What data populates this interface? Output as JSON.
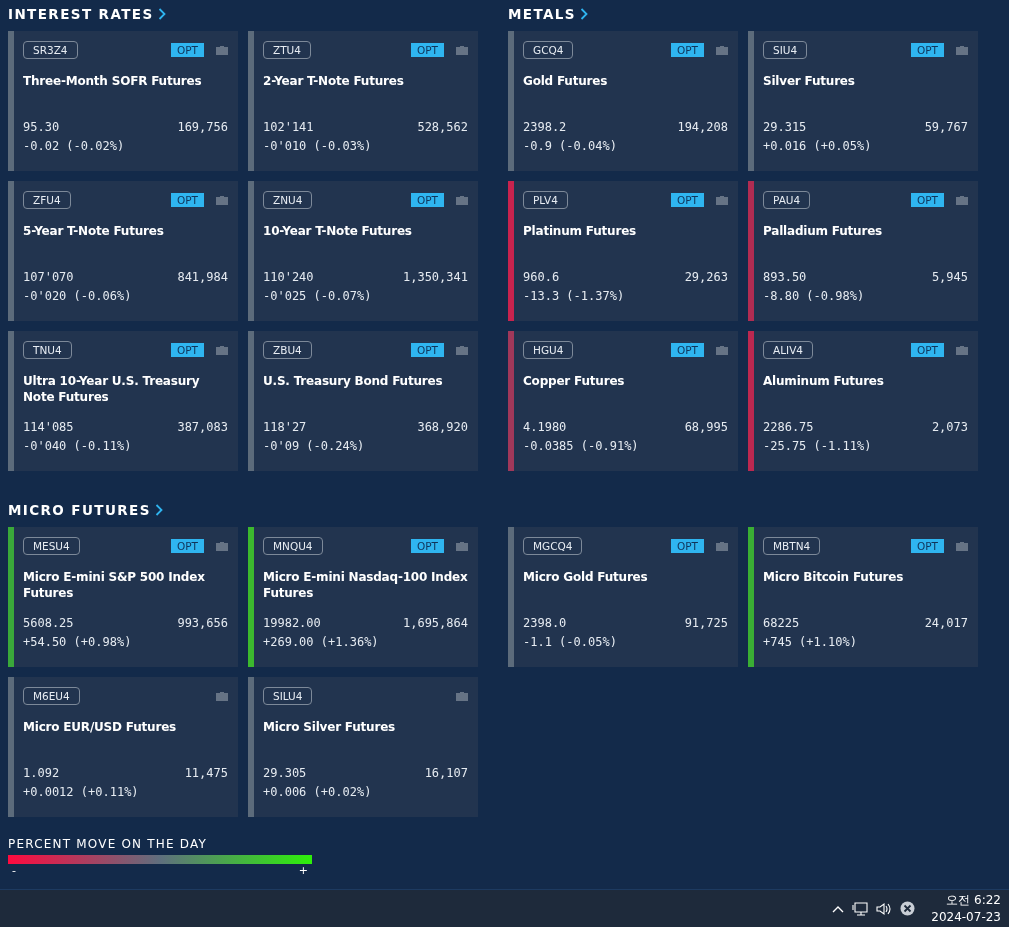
{
  "sections": [
    {
      "kind": "half",
      "title": "INTEREST RATES",
      "cards": [
        {
          "ticker": "SR3Z4",
          "badge": "OPT",
          "name": "Three-Month SOFR Futures",
          "price": "95.30",
          "volume": "169,756",
          "change": "-0.02 (-0.02%)",
          "color": "#5c6b7b"
        },
        {
          "ticker": "ZTU4",
          "badge": "OPT",
          "name": "2-Year T-Note Futures",
          "price": "102'141",
          "volume": "528,562",
          "change": "-0'010 (-0.03%)",
          "color": "#5c6b7b"
        },
        {
          "ticker": "ZFU4",
          "badge": "OPT",
          "name": "5-Year T-Note Futures",
          "price": "107'070",
          "volume": "841,984",
          "change": "-0'020 (-0.06%)",
          "color": "#5c6b7b"
        },
        {
          "ticker": "ZNU4",
          "badge": "OPT",
          "name": "10-Year T-Note Futures",
          "price": "110'240",
          "volume": "1,350,341",
          "change": "-0'025 (-0.07%)",
          "color": "#5c6b7b"
        },
        {
          "ticker": "TNU4",
          "badge": "OPT",
          "name": "Ultra 10-Year U.S. Treasury Note Futures",
          "price": "114'085",
          "volume": "387,083",
          "change": "-0'040 (-0.11%)",
          "color": "#5c6b7b"
        },
        {
          "ticker": "ZBU4",
          "badge": "OPT",
          "name": "U.S. Treasury Bond Futures",
          "price": "118'27",
          "volume": "368,920",
          "change": "-0'09 (-0.24%)",
          "color": "#5c6b7b"
        }
      ]
    },
    {
      "kind": "half",
      "title": "METALS",
      "cards": [
        {
          "ticker": "GCQ4",
          "badge": "OPT",
          "name": "Gold Futures",
          "price": "2398.2",
          "volume": "194,208",
          "change": "-0.9 (-0.04%)",
          "color": "#5c6b7b"
        },
        {
          "ticker": "SIU4",
          "badge": "OPT",
          "name": "Silver Futures",
          "price": "29.315",
          "volume": "59,767",
          "change": "+0.016 (+0.05%)",
          "color": "#5c6b7b"
        },
        {
          "ticker": "PLV4",
          "badge": "OPT",
          "name": "Platinum Futures",
          "price": "960.6",
          "volume": "29,263",
          "change": "-13.3 (-1.37%)",
          "color": "#c8234e"
        },
        {
          "ticker": "PAU4",
          "badge": "OPT",
          "name": "Palladium Futures",
          "price": "893.50",
          "volume": "5,945",
          "change": "-8.80 (-0.98%)",
          "color": "#b02c52"
        },
        {
          "ticker": "HGU4",
          "badge": "OPT",
          "name": "Copper Futures",
          "price": "4.1980",
          "volume": "68,995",
          "change": "-0.0385 (-0.91%)",
          "color": "#a0385a"
        },
        {
          "ticker": "ALIV4",
          "badge": "OPT",
          "name": "Aluminum Futures",
          "price": "2286.75",
          "volume": "2,073",
          "change": "-25.75 (-1.11%)",
          "color": "#bb2850"
        }
      ]
    },
    {
      "kind": "full",
      "title": "MICRO FUTURES",
      "cards": [
        {
          "ticker": "MESU4",
          "badge": "OPT",
          "name": "Micro E-mini S&P 500 Index Futures",
          "price": "5608.25",
          "volume": "993,656",
          "change": "+54.50 (+0.98%)",
          "color": "#3aa83a"
        },
        {
          "ticker": "MNQU4",
          "badge": "OPT",
          "name": "Micro E-mini Nasdaq-100 Index Futures",
          "price": "19982.00",
          "volume": "1,695,864",
          "change": "+269.00 (+1.36%)",
          "color": "#3cb82e"
        },
        {
          "ticker": "MGCQ4",
          "badge": "OPT",
          "name": "Micro Gold Futures",
          "price": "2398.0",
          "volume": "91,725",
          "change": "-1.1 (-0.05%)",
          "color": "#5c6b7b"
        },
        {
          "ticker": "MBTN4",
          "badge": "OPT",
          "name": "Micro Bitcoin Futures",
          "price": "68225",
          "volume": "24,017",
          "change": "+745 (+1.10%)",
          "color": "#3aae34"
        },
        {
          "ticker": "M6EU4",
          "name": "Micro EUR/USD Futures",
          "price": "1.092",
          "volume": "11,475",
          "change": "+0.0012 (+0.11%)",
          "color": "#5c6b7b"
        },
        {
          "ticker": "SILU4",
          "name": "Micro Silver Futures",
          "price": "29.305",
          "volume": "16,107",
          "change": "+0.006 (+0.02%)",
          "color": "#5c6b7b"
        }
      ]
    }
  ],
  "legend": {
    "title": "PERCENT MOVE ON THE DAY",
    "min_label": "-",
    "max_label": "+"
  },
  "taskbar": {
    "time": "오전 6:22",
    "date": "2024-07-23"
  }
}
